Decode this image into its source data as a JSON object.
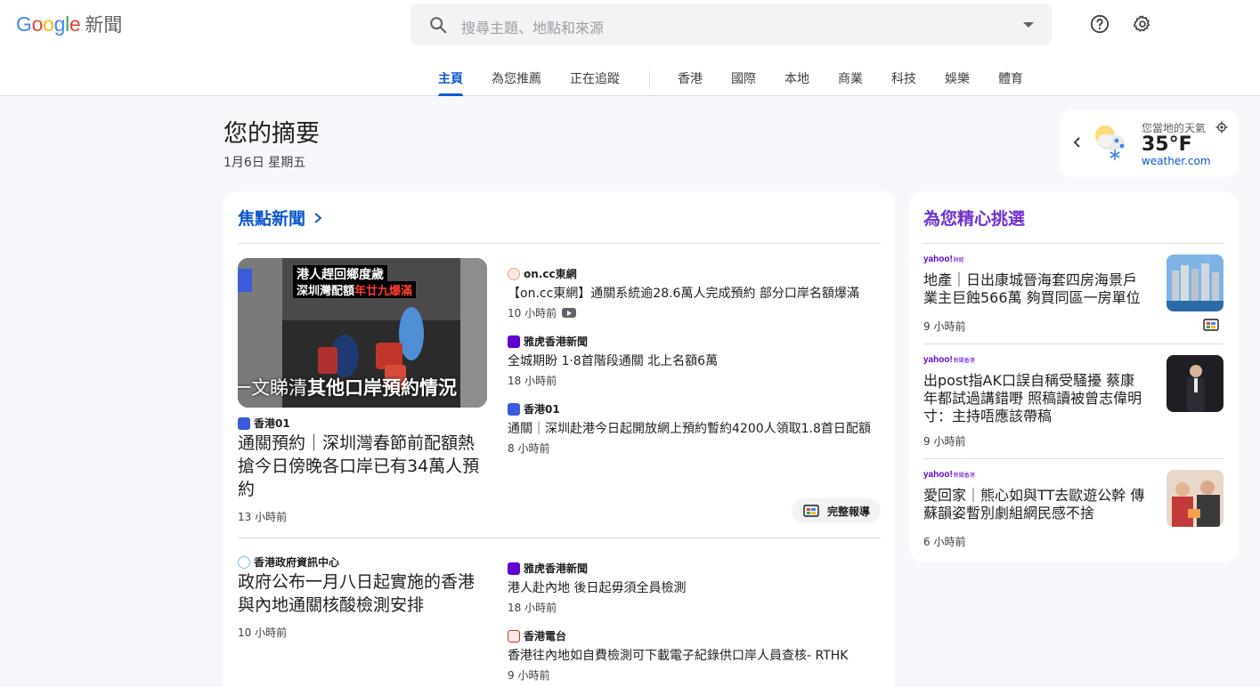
{
  "header": {
    "logo_letters": [
      "G",
      "o",
      "o",
      "g",
      "l",
      "e"
    ],
    "logo_colors": [
      "#4285f4",
      "#ea4335",
      "#fbbc05",
      "#4285f4",
      "#34a853",
      "#ea4335"
    ],
    "logo_suffix": "新聞",
    "search_placeholder": "搜尋主題、地點和來源",
    "help_icon": "help-icon",
    "settings_icon": "gear-icon"
  },
  "nav": {
    "tabs": [
      "主頁",
      "為您推薦",
      "正在追蹤",
      "香港",
      "國際",
      "本地",
      "商業",
      "科技",
      "娛樂",
      "體育"
    ],
    "active_index": 0
  },
  "summary": {
    "title": "您的摘要",
    "date": "1月6日 星期五"
  },
  "weather": {
    "label": "您當地的天氣",
    "temperature": "35°F",
    "source": "weather.com"
  },
  "top_stories": {
    "heading": "焦點新聞",
    "cluster1": {
      "main": {
        "image_caption_top1": "港人趕回鄉度歲",
        "image_caption_top2a": "深圳灣配額",
        "image_caption_top2b": "年廿九爆滿",
        "image_caption_bottom_a": "一文睇清",
        "image_caption_bottom_b": "其他口岸預約情況",
        "source": "香港01",
        "headline": "通關預約｜深圳灣春節前配額熱搶今日傍晚各口岸已有34萬人預約",
        "time": "13 小時前"
      },
      "related": [
        {
          "source": "on.cc東網",
          "headline": "【on.cc東網】通關系統逾28.6萬人完成預約 部分口岸名額爆滿",
          "time": "10 小時前"
        },
        {
          "source": "雅虎香港新聞",
          "headline": "全城期盼 1·8首階段通關 北上名額6萬",
          "time": "18 小時前"
        },
        {
          "source": "香港01",
          "headline": "通關｜深圳赴港今日起開放網上預約暫約4200人領取1.8首日配額",
          "time": "8 小時前"
        }
      ],
      "full_coverage": "完整報導"
    },
    "cluster2": {
      "main": {
        "source": "香港政府資訊中心",
        "headline": "政府公布一月八日起實施的香港與內地通關核酸檢測安排",
        "time": "10 小時前"
      },
      "related": [
        {
          "source": "雅虎香港新聞",
          "headline": "港人赴內地 後日起毋須全員檢測",
          "time": "18 小時前"
        },
        {
          "source": "香港電台",
          "headline": "香港往內地如自費檢測可下載電子紀錄供口岸人員查核- RTHK",
          "time": "9 小時前"
        }
      ]
    }
  },
  "picks": {
    "heading": "為您精心挑選",
    "items": [
      {
        "source_logo": "yahoo!",
        "source_logo_sub": "財經",
        "headline": "地產｜日出康城晉海套四房海景戶業主巨蝕566萬 夠買同區一房單位",
        "time": "9 小時前"
      },
      {
        "source_logo": "yahoo!",
        "source_logo_sub": "新聞香港",
        "headline": "出post指AK口誤自稱受騷擾 蔡康年都試過講錯嘢 照稿讀被曾志偉明寸：主持唔應該帶稿",
        "time": "9 小時前"
      },
      {
        "source_logo": "yahoo!",
        "source_logo_sub": "新聞香港",
        "headline": "愛回家｜熊心如與TT去歐遊公幹 傳蘇韻姿暫別劇組網民感不捨",
        "time": "6 小時前"
      }
    ]
  },
  "colors": {
    "accent": "#0b57d0",
    "picks_accent": "#6f32d1",
    "yahoo": "#6001d2",
    "hk01": "#3b5bdb"
  }
}
